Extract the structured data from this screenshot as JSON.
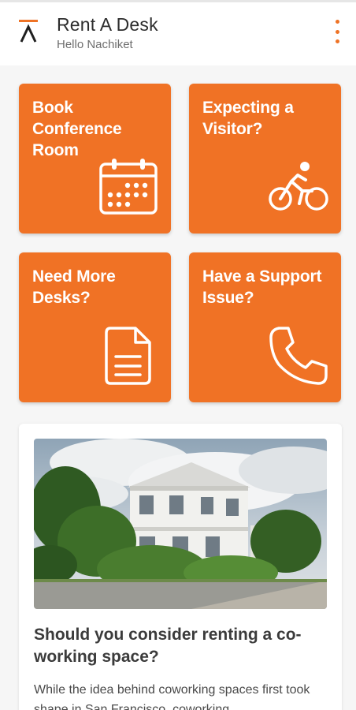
{
  "header": {
    "title": "Rent A Desk",
    "greeting": "Hello Nachiket",
    "logo_icon": "caret-up-logo-icon",
    "menu_icon": "overflow-vertical-icon"
  },
  "tiles": [
    {
      "label": "Book Conference Room",
      "icon": "calendar-icon"
    },
    {
      "label": "Expecting a Visitor?",
      "icon": "bicycle-icon"
    },
    {
      "label": "Need More Desks?",
      "icon": "document-icon"
    },
    {
      "label": "Have a Support Issue?",
      "icon": "phone-icon"
    }
  ],
  "article": {
    "title": "Should you consider renting a co-working space?",
    "excerpt": "While the idea behind coworking spaces first took shape in San Francisco, coworking"
  },
  "colors": {
    "accent": "#F07225",
    "header_bg": "#FFFFFF",
    "page_bg": "#F6F6F6"
  }
}
